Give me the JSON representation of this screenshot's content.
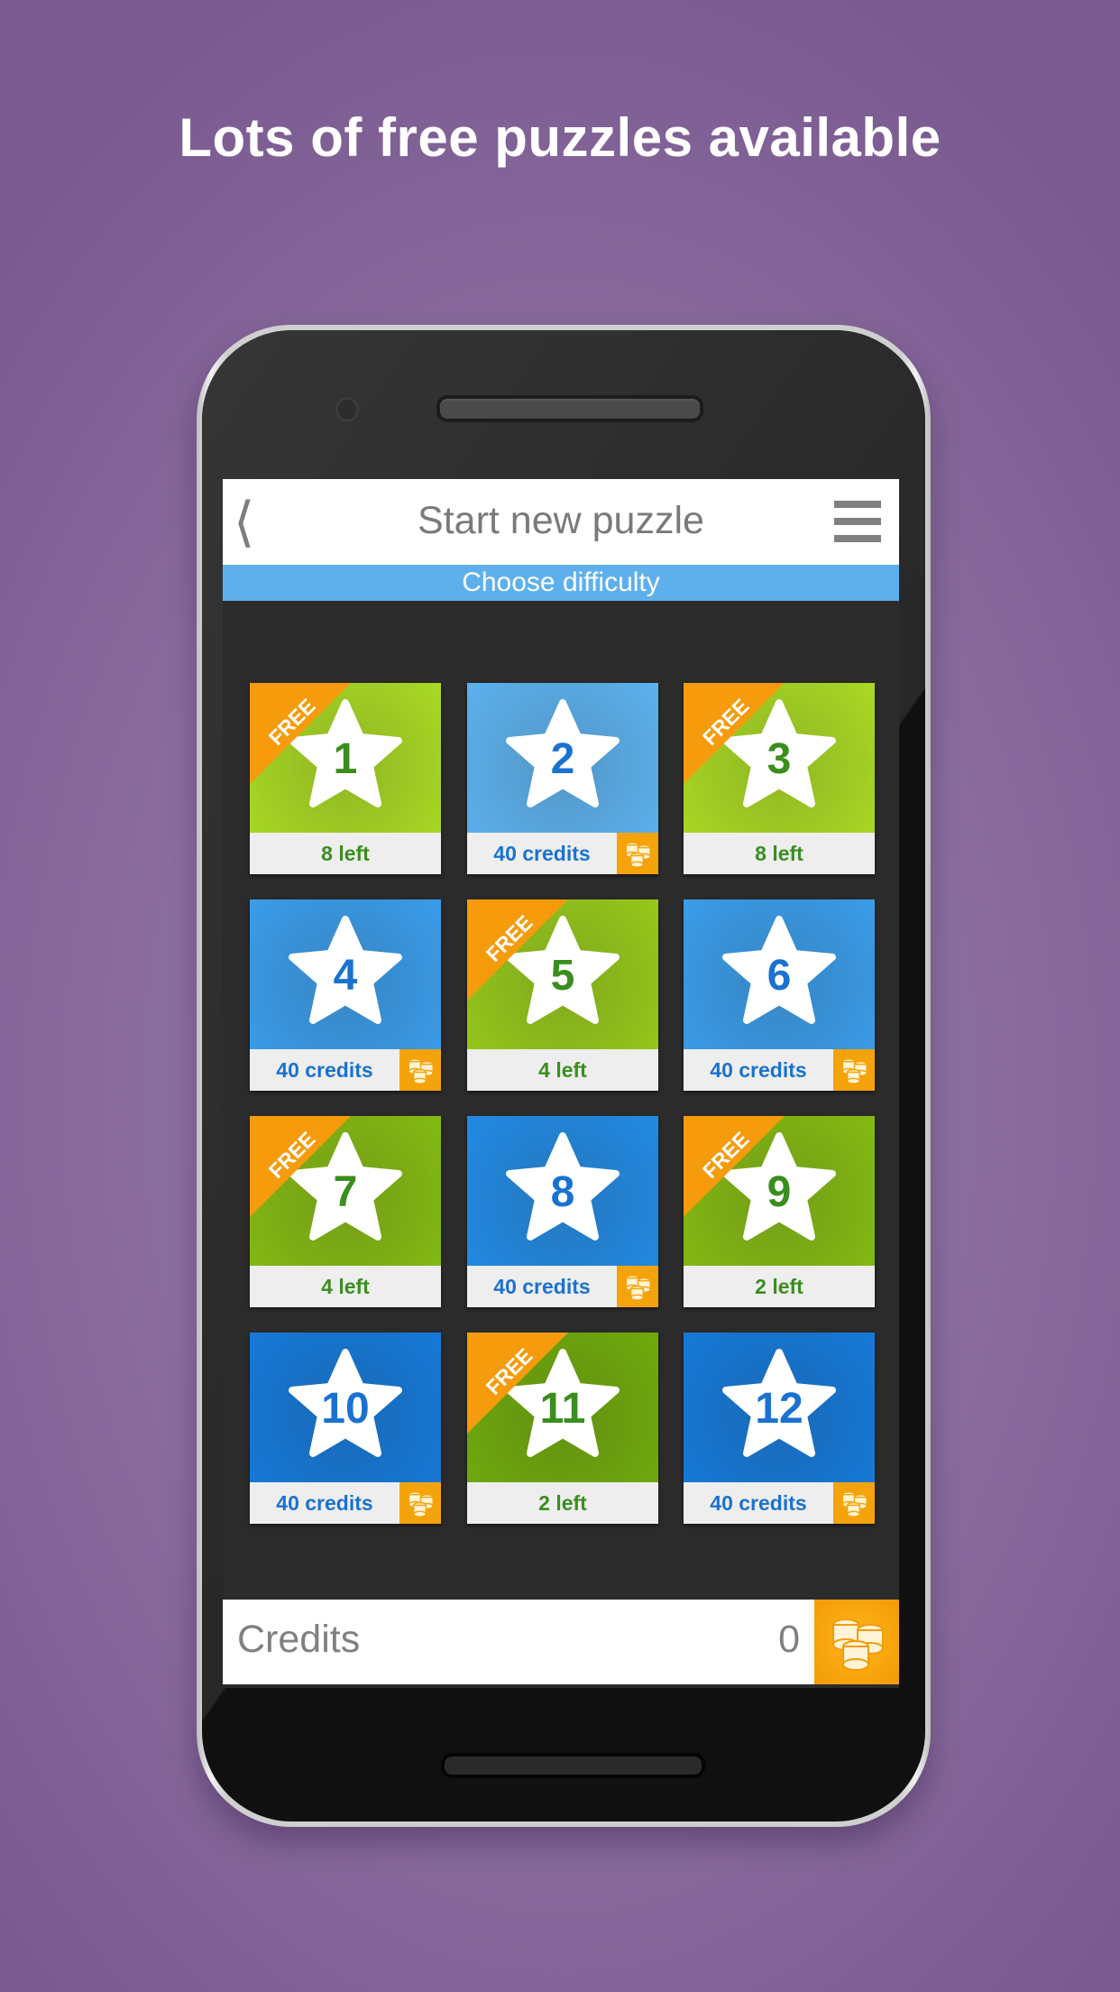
{
  "headline": "Lots of free puzzles available",
  "app": {
    "title": "Start new puzzle",
    "subtitle": "Choose difficulty",
    "back_icon": "chevron-left-icon",
    "menu_icon": "hamburger-menu-icon"
  },
  "colors": {
    "background": "#8a6c9f",
    "subtitle_bar": "#5eb0ec",
    "ribbon": "#f59b0c",
    "coin_badge": "#f5a30b",
    "free_text": "#3a8e1e",
    "paid_text": "#1a72d0"
  },
  "tiles": [
    {
      "number": "1",
      "type": "free",
      "ribbon": "FREE",
      "footer": "8 left",
      "color": "#a9d923"
    },
    {
      "number": "2",
      "type": "paid",
      "ribbon": "",
      "footer": "40 credits",
      "color": "#5cb1ee"
    },
    {
      "number": "3",
      "type": "free",
      "ribbon": "FREE",
      "footer": "8 left",
      "color": "#a9d923"
    },
    {
      "number": "4",
      "type": "paid",
      "ribbon": "",
      "footer": "40 credits",
      "color": "#3a9ce9"
    },
    {
      "number": "5",
      "type": "free",
      "ribbon": "FREE",
      "footer": "4 left",
      "color": "#96c81a"
    },
    {
      "number": "6",
      "type": "paid",
      "ribbon": "",
      "footer": "40 credits",
      "color": "#3a9ce9"
    },
    {
      "number": "7",
      "type": "free",
      "ribbon": "FREE",
      "footer": "4 left",
      "color": "#84ba12"
    },
    {
      "number": "8",
      "type": "paid",
      "ribbon": "",
      "footer": "40 credits",
      "color": "#228ae3"
    },
    {
      "number": "9",
      "type": "free",
      "ribbon": "FREE",
      "footer": "2 left",
      "color": "#84ba12"
    },
    {
      "number": "10",
      "type": "paid",
      "ribbon": "",
      "footer": "40 credits",
      "color": "#1579d8"
    },
    {
      "number": "11",
      "type": "free",
      "ribbon": "FREE",
      "footer": "2 left",
      "color": "#70aa0c"
    },
    {
      "number": "12",
      "type": "paid",
      "ribbon": "",
      "footer": "40 credits",
      "color": "#1579d8"
    }
  ],
  "credits": {
    "label": "Credits",
    "value": "0",
    "icon": "coins-icon"
  }
}
